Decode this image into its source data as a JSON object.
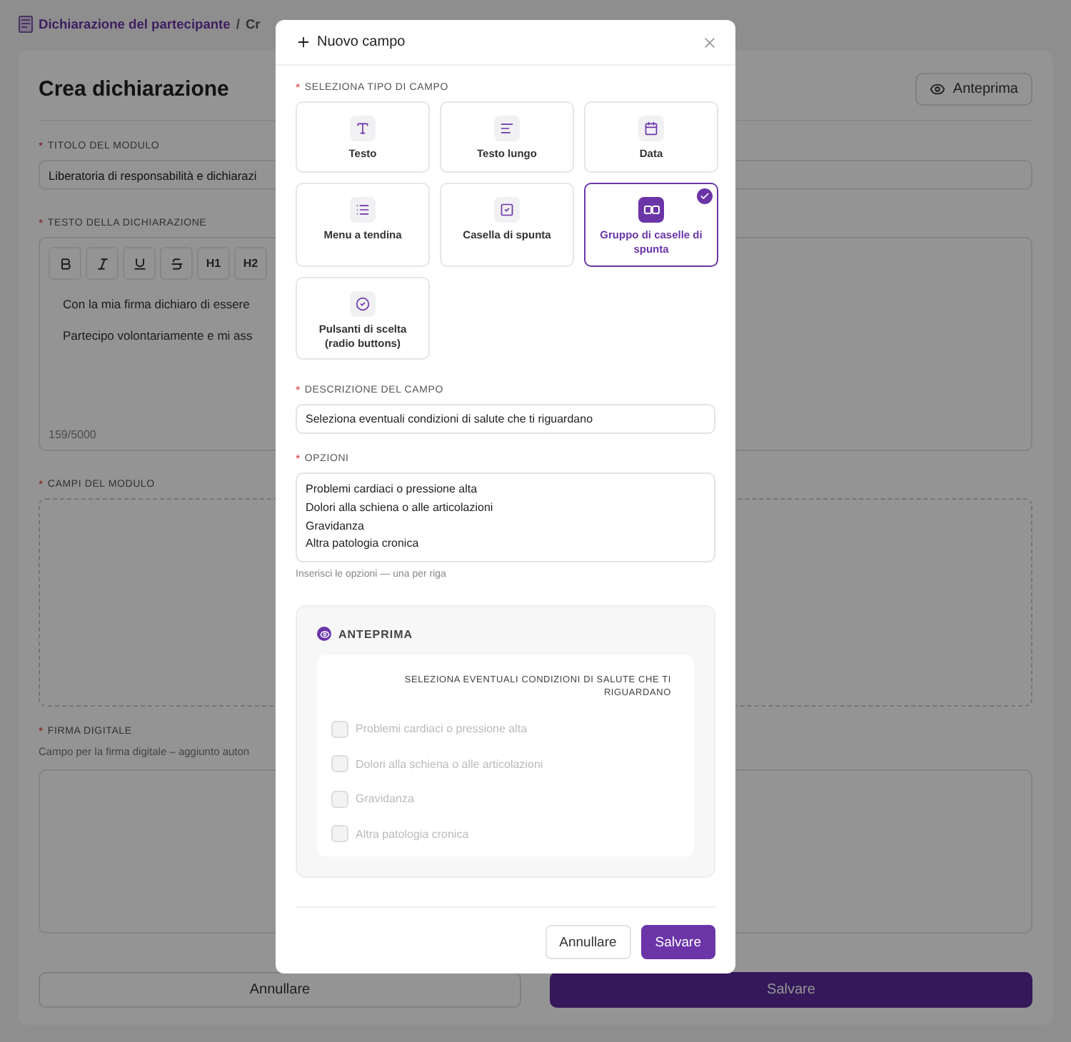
{
  "breadcrumb": {
    "parent": "Dichiarazione del partecipante",
    "separator": "/",
    "current": "Cr"
  },
  "page": {
    "title": "Crea dichiarazione",
    "preview_button": "Anteprima",
    "form_title": {
      "mark": "*",
      "label": "TITOLO DEL MODULO",
      "value": "Liberatoria di responsabilità e dichiarazi"
    },
    "statement": {
      "mark": "*",
      "label": "TESTO DELLA DICHIARAZIONE",
      "toolbar": [
        {
          "kind": "bold"
        },
        {
          "kind": "italic"
        },
        {
          "kind": "underline"
        },
        {
          "kind": "strike"
        },
        {
          "kind": "heading",
          "label": "H1"
        },
        {
          "kind": "heading",
          "label": "H2"
        }
      ],
      "paragraphs": [
        "Con la mia firma dichiaro di essere",
        "Partecipo volontariamente e mi ass"
      ],
      "counter": "159/5000"
    },
    "fields": {
      "mark": "*",
      "label": "CAMPI DEL MODULO"
    },
    "signature": {
      "mark": "*",
      "label": "FIRMA DIGITALE",
      "hint": "Campo per la firma digitale – aggiunto auton"
    },
    "buttons": {
      "cancel": "Annullare",
      "save": "Salvare"
    }
  },
  "dialog": {
    "title": "Nuovo campo",
    "type_label": {
      "mark": "*",
      "label": "SELEZIONA TIPO DI CAMPO"
    },
    "types": [
      {
        "kind": "text",
        "label": "Testo",
        "selected": false
      },
      {
        "kind": "longtext",
        "label": "Testo lungo",
        "selected": false
      },
      {
        "kind": "date",
        "label": "Data",
        "selected": false
      },
      {
        "kind": "dropdown",
        "label": "Menu a tendina",
        "selected": false
      },
      {
        "kind": "checkbox",
        "label": "Casella di spunta",
        "selected": false
      },
      {
        "kind": "checkgroup",
        "label": "Gruppo di caselle di spunta",
        "selected": true
      },
      {
        "kind": "radio",
        "label": "Pulsanti di scelta (radio buttons)",
        "selected": false
      }
    ],
    "description": {
      "mark": "*",
      "label": "DESCRIZIONE DEL CAMPO",
      "value": "Seleziona eventuali condizioni di salute che ti riguardano"
    },
    "options": {
      "mark": "*",
      "label": "OPZIONI",
      "lines": [
        "Problemi cardiaci o pressione alta",
        "Dolori alla schiena o alle articolazioni",
        "Gravidanza",
        "Altra patologia cronica"
      ],
      "hint": "Inserisci le opzioni — una per riga"
    },
    "preview": {
      "title": "ANTEPRIMA",
      "question": "SELEZIONA EVENTUALI CONDIZIONI DI SALUTE CHE TI RIGUARDANO",
      "items": [
        {
          "label": "Problemi cardiaci o pressione alta",
          "checked": false
        },
        {
          "label": "Dolori alla schiena o alle articolazioni",
          "checked": false
        },
        {
          "label": "Gravidanza",
          "checked": false
        },
        {
          "label": "Altra patologia cronica",
          "checked": false
        }
      ]
    },
    "buttons": {
      "cancel": "Annullare",
      "save": "Salvare"
    }
  }
}
